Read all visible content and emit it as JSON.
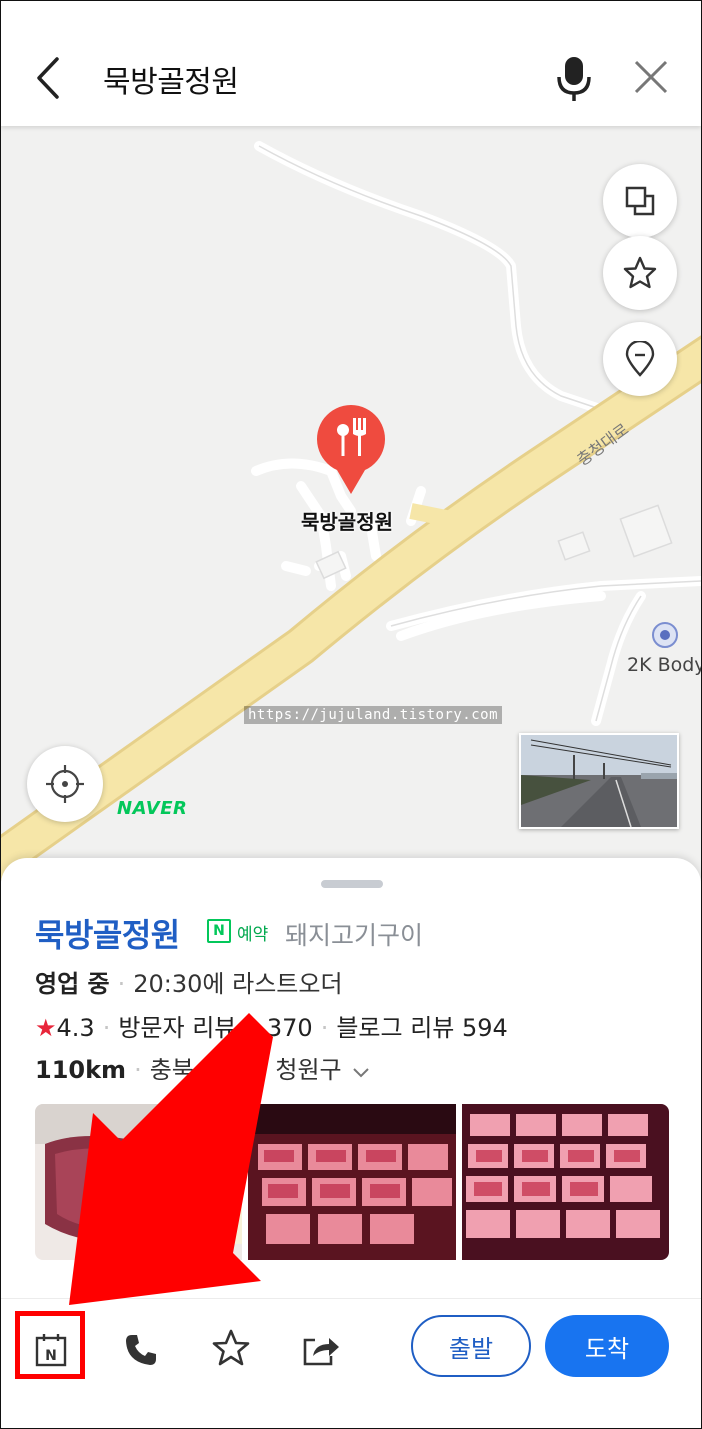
{
  "search": {
    "query": "묵방골정원"
  },
  "map": {
    "place_label": "묵방골정원",
    "road_label": "충청대로",
    "poi_label": "2K Body",
    "watermark": "https://jujuland.tistory.com",
    "naver_logo": "NAVER",
    "controls": [
      "layers-icon",
      "star-icon",
      "location-pin-icon",
      "current-location-icon"
    ]
  },
  "place": {
    "name": "묵방골정원",
    "badge": "N",
    "reserve_label": "예약",
    "category": "돼지고기구이",
    "status": "영업 중",
    "last_order": "20:30에 라스트오더",
    "rating": "4.3",
    "visitor_reviews": "방문자 리뷰 2,370",
    "blog_reviews": "블로그 리뷰 594",
    "distance": "110km",
    "address": "충북 청주시 청원구"
  },
  "actions": {
    "depart_label": "출발",
    "arrive_label": "도착",
    "icons": [
      "naver-booking-icon",
      "phone-icon",
      "star-icon",
      "share-icon"
    ]
  },
  "colors": {
    "accent_blue": "#1f5ec4",
    "arrive_blue": "#1874f0",
    "naver_green": "#03c75a",
    "pin_red": "#ef4b3f",
    "annotation_red": "#ff0000"
  }
}
